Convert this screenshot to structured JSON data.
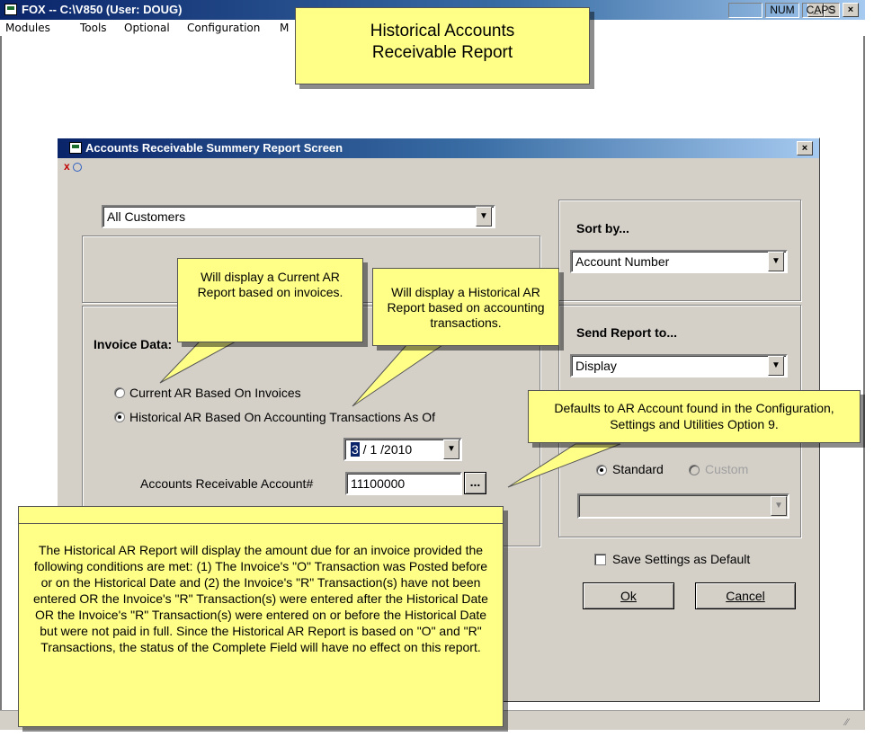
{
  "app": {
    "title": "FOX -- C:\\V850  (User: DOUG)",
    "menu": [
      "Modules",
      "Tools",
      "Optional",
      "Configuration",
      "M"
    ],
    "caption_buttons": [
      "_",
      "□",
      "×"
    ]
  },
  "status": {
    "num": "NUM",
    "caps": "CAPS"
  },
  "dialog": {
    "title": "Accounts Receivable Summery Report Screen",
    "close": "×",
    "customer_filter": "All Customers",
    "sort_by_label": "Sort by...",
    "sort_by_value": "Account Number",
    "invoice_data_label": "Invoice Data:",
    "current_ar_option": "Current AR Based On Invoices",
    "historical_ar_option": "Historical AR Based On Accounting Transactions As Of",
    "date_value": {
      "month": "3",
      "rest": " / 1 /2010"
    },
    "ar_account_label": "Accounts Receivable Account#",
    "ar_account_value": "11100000",
    "browse_button": "...",
    "send_report_label": "Send Report to...",
    "send_report_value": "Display",
    "format_standard": "Standard",
    "format_custom": "Custom",
    "save_settings_label": "Save Settings as Default",
    "ok_button": "Ok",
    "cancel_button": "Cancel"
  },
  "callouts": {
    "header": "Historical Accounts Receivable Report",
    "current_ar": "Will display a Current AR Report based on invoices.",
    "historical_ar": "Will display a Historical AR Report based on accounting transactions.",
    "defaults": "Defaults to AR Account found in the Configuration, Settings and Utilities Option 9.",
    "explanation": "The Historical AR Report will display the amount due for an invoice provided the following conditions are met: (1) The Invoice's \"O\" Transaction was Posted before or on the Historical Date and (2) the Invoice's \"R\" Transaction(s) have not been entered OR the Invoice's \"R\" Transaction(s) were entered after the Historical Date OR the Invoice's \"R\" Transaction(s) were entered on or before the Historical Date but were not paid in full.  Since the Historical AR Report is based on \"O\" and \"R\" Transactions, the status of the Complete Field will have no effect on this report."
  },
  "colors": {
    "callout_fill": "#ffff88",
    "titlebar_dark": "#0a246a",
    "dialog_face": "#d4d0c8"
  }
}
